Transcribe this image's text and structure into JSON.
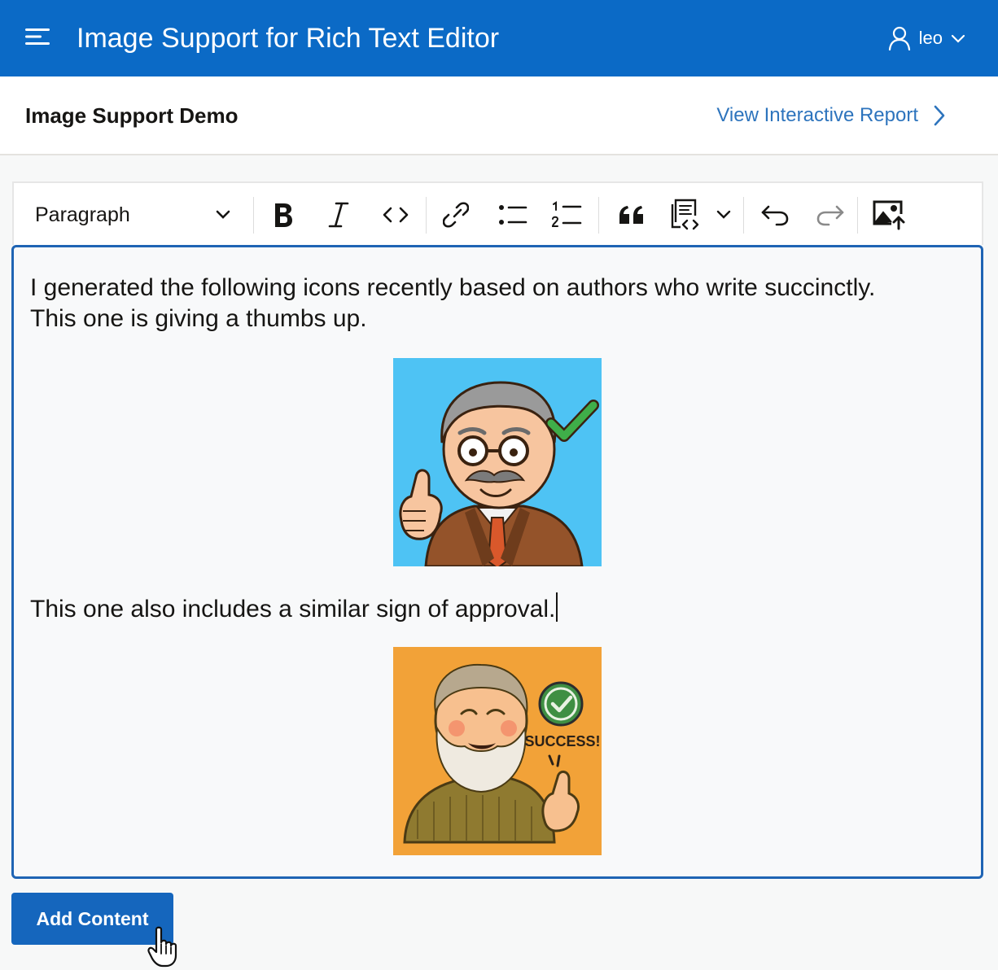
{
  "app": {
    "title": "Image Support for Rich Text Editor",
    "user": "leo"
  },
  "region": {
    "title": "Image Support Demo",
    "link_label": "View Interactive Report"
  },
  "toolbar": {
    "format_value": "Paragraph"
  },
  "editor": {
    "para1_line1": "I generated the following icons recently based on authors who write succinctly.",
    "para1_line2": "This one is giving a thumbs up.",
    "para2": "This one also includes a similar sign of approval.",
    "image2_caption": "SUCCESS!"
  },
  "actions": {
    "add_content_label": "Add Content"
  },
  "colors": {
    "header": "#0b6ac6",
    "link": "#2d74bd",
    "button": "#1566bd",
    "editor_border": "#1f64b4",
    "image1_bg": "#4ec3f4",
    "image2_bg": "#f2a238"
  }
}
